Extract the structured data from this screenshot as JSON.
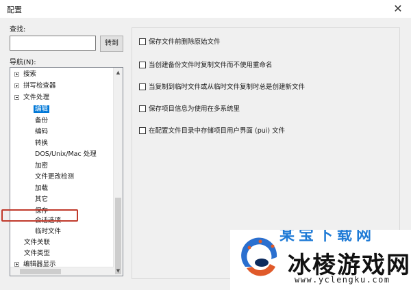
{
  "window": {
    "title": "配置",
    "close_symbol": "✕"
  },
  "search": {
    "label": "查找:",
    "value": "",
    "placeholder": "",
    "button_label": "转到"
  },
  "nav": {
    "label": "导航(N):",
    "items": [
      {
        "label": "搜索",
        "expander": "plus"
      },
      {
        "label": "拼写检查器",
        "expander": "plus"
      },
      {
        "label": "文件处理",
        "expander": "minus"
      },
      {
        "label": "编辑"
      },
      {
        "label": "备份"
      },
      {
        "label": "编码"
      },
      {
        "label": "转换"
      },
      {
        "label": "DOS/Unix/Mac 处理"
      },
      {
        "label": "加密"
      },
      {
        "label": "文件更改检测"
      },
      {
        "label": "加载"
      },
      {
        "label": "其它"
      },
      {
        "label": "保存"
      },
      {
        "label": "会话选项"
      },
      {
        "label": "临时文件"
      },
      {
        "label": "文件关联"
      },
      {
        "label": "文件类型"
      },
      {
        "label": "编辑器显示",
        "expander": "plus"
      }
    ]
  },
  "options": [
    {
      "label": "保存文件前删除原始文件",
      "checked": false
    },
    {
      "label": "当创建备份文件时复制文件而不使用重命名",
      "checked": false
    },
    {
      "label": "当复制到临时文件或从临时文件复制时总是创建新文件",
      "checked": false
    },
    {
      "label": "保存项目信息为使用在多系统里",
      "checked": false
    },
    {
      "label": "在配置文件目录中存储项目用户界面 (pui) 文件",
      "checked": false
    }
  ],
  "watermark": {
    "name": "冰棱游戏网",
    "url": "www.yclengku.com",
    "top_text": "某宝下载网"
  },
  "colors": {
    "selection": "#0078d7",
    "highlight_box": "#c0392b",
    "watermark_blue": "#1f7bd6"
  }
}
